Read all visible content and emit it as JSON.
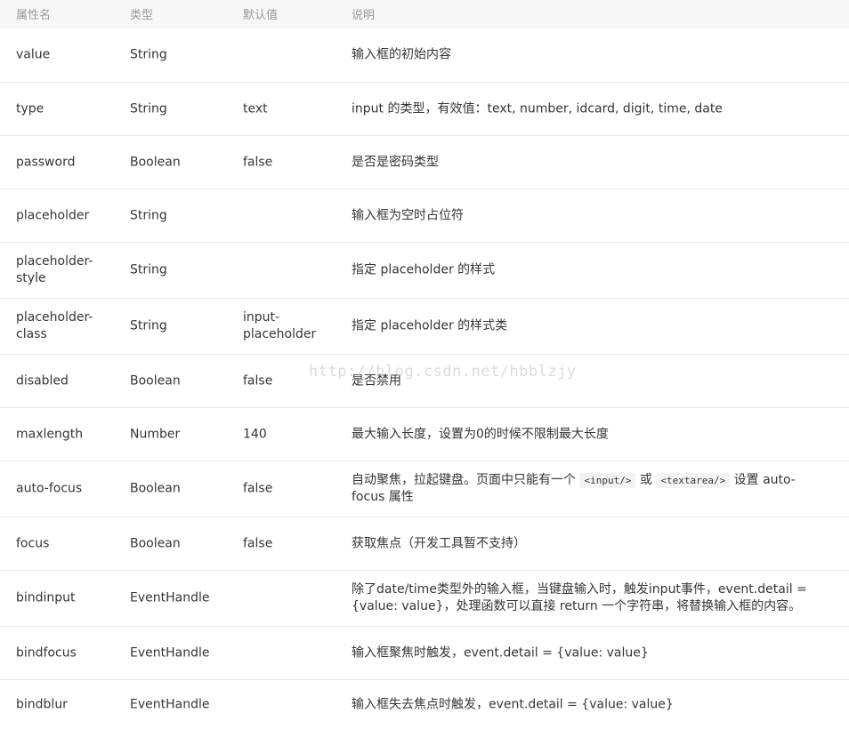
{
  "header": {
    "name": "属性名",
    "type": "类型",
    "default": "默认值",
    "desc": "说明"
  },
  "rows": [
    {
      "name": "value",
      "type": "String",
      "default": "",
      "desc": "输入框的初始内容"
    },
    {
      "name": "type",
      "type": "String",
      "default": "text",
      "desc": "input 的类型，有效值：text, number, idcard, digit, time, date"
    },
    {
      "name": "password",
      "type": "Boolean",
      "default": "false",
      "desc": "是否是密码类型"
    },
    {
      "name": "placeholder",
      "type": "String",
      "default": "",
      "desc": "输入框为空时占位符"
    },
    {
      "name_lines": [
        "placeholder-",
        "style"
      ],
      "type": "String",
      "default": "",
      "desc": "指定 placeholder 的样式"
    },
    {
      "name_lines": [
        "placeholder-",
        "class"
      ],
      "type": "String",
      "default_lines": [
        "input-",
        "placeholder"
      ],
      "desc": "指定 placeholder 的样式类"
    },
    {
      "name": "disabled",
      "type": "Boolean",
      "default": "false",
      "desc": "是否禁用"
    },
    {
      "name": "maxlength",
      "type": "Number",
      "default": "140",
      "desc": "最大输入长度，设置为0的时候不限制最大长度"
    },
    {
      "name": "auto-focus",
      "type": "Boolean",
      "default": "false",
      "desc_parts": {
        "a": "自动聚焦，拉起键盘。页面中只能有一个",
        "code1": "<input/>",
        "b": "或",
        "code2": "<textarea/>",
        "c": "设置 auto-",
        "d": "focus 属性"
      }
    },
    {
      "name": "focus",
      "type": "Boolean",
      "default": "false",
      "desc": "获取焦点（开发工具暂不支持）"
    },
    {
      "name": "bindinput",
      "type": "EventHandle",
      "default": "",
      "desc_lines": [
        "除了date/time类型外的输入框，当键盘输入时，触发input事件，event.detail =",
        "{value: value}，处理函数可以直接 return 一个字符串，将替换输入框的内容。"
      ]
    },
    {
      "name": "bindfocus",
      "type": "EventHandle",
      "default": "",
      "desc": "输入框聚焦时触发，event.detail = {value: value}"
    },
    {
      "name": "bindblur",
      "type": "EventHandle",
      "default": "",
      "desc": "输入框失去焦点时触发，event.detail = {value: value}"
    }
  ],
  "watermark": "http://blog.csdn.net/hbblzjy"
}
